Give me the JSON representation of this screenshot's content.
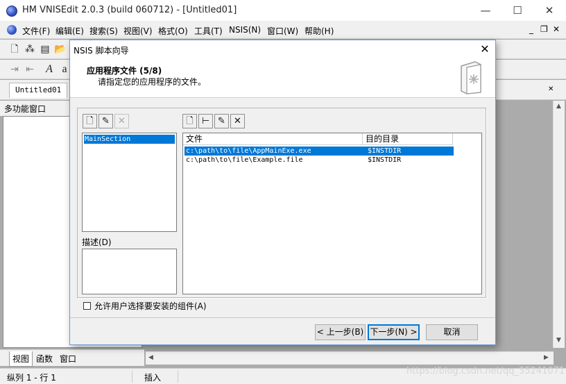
{
  "app": {
    "title": "HM VNISEdit 2.0.3 (build 060712) - [Untitled01]",
    "window_buttons": {
      "minimize": "—",
      "maximize": "☐",
      "close": "✕"
    }
  },
  "menu": {
    "items": [
      "文件(F)",
      "编辑(E)",
      "搜索(S)",
      "视图(V)",
      "格式(O)",
      "工具(T)",
      "NSIS(N)",
      "窗口(W)",
      "帮助(H)"
    ],
    "mdi": {
      "minimize": "_",
      "restore": "❐",
      "close": "✕"
    }
  },
  "document_tab": "Untitled01",
  "left_pane": {
    "title": "多功能窗口",
    "tabs": [
      "视图",
      "函数",
      "窗口"
    ]
  },
  "statusbar": {
    "position": "纵列 1 - 行 1",
    "mode": "插入"
  },
  "watermark": "https://blog.csdn.net/qq_35241071",
  "dialog": {
    "title": "NSIS 脚本向导",
    "close": "✕",
    "heading": "应用程序文件 (5/8)",
    "subheading": "请指定您的应用程序的文件。",
    "sections": [
      "MainSection"
    ],
    "description_label": "描述(D)",
    "description_text": "",
    "files": {
      "columns": [
        "文件",
        "目的目录"
      ],
      "rows": [
        {
          "file": "c:\\path\\to\\file\\AppMainExe.exe",
          "dest": "$INSTDIR",
          "selected": true
        },
        {
          "file": "c:\\path\\to\\file\\Example.file",
          "dest": "$INSTDIR",
          "selected": false
        }
      ]
    },
    "checkbox_label": "允许用户选择要安装的组件(A)",
    "checkbox_checked": false,
    "buttons": {
      "back": "< 上一步(B)",
      "next": "下一步(N) >",
      "cancel": "取消"
    }
  },
  "icons": {
    "section_new": "new-doc-icon",
    "section_edit": "edit-icon",
    "section_delete": "delete-icon",
    "file_new": "new-doc-icon",
    "file_tree": "tree-icon",
    "file_edit": "edit-icon",
    "file_delete": "delete-icon"
  },
  "colors": {
    "selection": "#0078d7",
    "desktop": "#ababab"
  }
}
